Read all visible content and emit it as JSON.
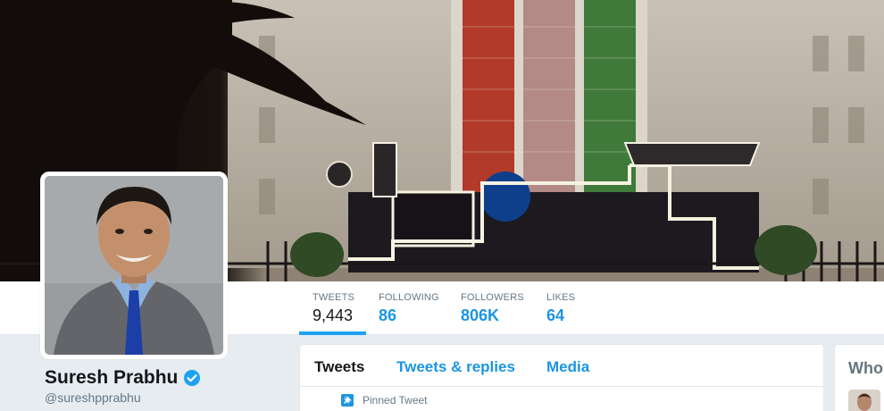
{
  "profile": {
    "name": "Suresh Prabhu",
    "handle": "@sureshpprabhu",
    "verified": true
  },
  "stats": [
    {
      "label": "TWEETS",
      "value": "9,443"
    },
    {
      "label": "FOLLOWING",
      "value": "86"
    },
    {
      "label": "FOLLOWERS",
      "value": "806K"
    },
    {
      "label": "LIKES",
      "value": "64"
    }
  ],
  "timeline": {
    "tabs": [
      "Tweets",
      "Tweets & replies",
      "Media"
    ],
    "pinned_label": "Pinned Tweet"
  },
  "sidebar": {
    "who_title": "Who"
  },
  "colors": {
    "accent": "#1da1f2",
    "link": "#1b95e0",
    "text": "#14171a",
    "muted": "#657786",
    "background": "#e6ecf0"
  },
  "icons": {
    "verified": "verified-badge-icon",
    "pinned": "pin-icon"
  }
}
